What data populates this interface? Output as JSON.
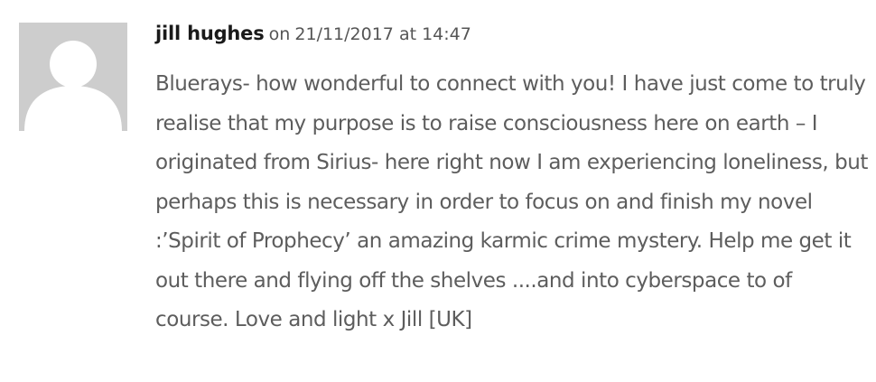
{
  "comment": {
    "avatar_icon": "default-avatar-icon",
    "author": "jill hughes",
    "on_word": "on",
    "date": "21/11/2017 at 14:47",
    "body": "Bluerays- how wonderful to connect with you! I have just come to truly realise that my purpose is to raise consciousness here on earth – I originated from Sirius- here right now I am experiencing loneliness, but perhaps this is necessary in order to focus on and finish my novel :’Spirit of Prophecy’ an amazing karmic crime mystery. Help me get it out there and flying off the shelves ....and into cyberspace to of course. Love and light x Jill [UK]"
  },
  "colors": {
    "avatar_bg": "#cdcdcd",
    "avatar_figure": "#ffffff",
    "author_text": "#1a1a1a",
    "meta_text": "#555555",
    "body_text": "#5d5d5d"
  }
}
